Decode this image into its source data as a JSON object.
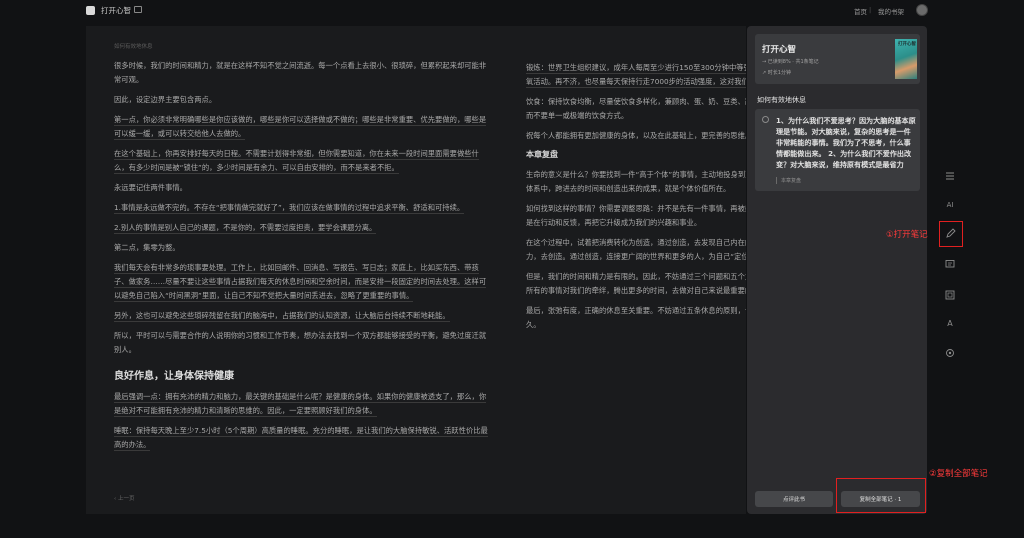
{
  "app": {
    "title": "打开心智",
    "nav_home": "首页",
    "nav_sep": "|",
    "nav_shelf": "我的书架"
  },
  "reader": {
    "chapter": "如何有效地休息",
    "left_paragraphs": [
      {
        "text": "很多时候，我们的时间和精力，就是在这样不知不觉之间流逝。每一个点看上去很小、很琐碎，但累积起来却可能非常可观。",
        "u": false
      },
      {
        "text": "因此，设定边界主要包含两点。",
        "u": false
      },
      {
        "text": "第一点，你必须非常明确哪些是你应该做的，哪些是你可以选择做或不做的；哪些是非常重要、优先要做的，哪些是可以缓一缓，或可以转交给他人去做的。",
        "u": true
      },
      {
        "text": "在这个基础上，你再安排好每天的日程。不需要计划得非常细，但你需要知道，你在未来一段时间里面需要做些什么，有多少时间是被“锁住”的，多少时间是有余力、可以自由安排的，而不是来者不拒。",
        "u": true
      },
      {
        "text": "永远要记住两件事情。",
        "u": false
      },
      {
        "text": "1.事情是永远做不完的。不存在“把事情做完就好了”，我们应该在做事情的过程中追求平衡、舒适和可持续。",
        "u": true
      },
      {
        "text": "2.别人的事情是别人自己的课题，不是你的，不需要过度担责，要学会课题分离。",
        "u": true
      },
      {
        "text": "第二点，集零为整。",
        "u": false
      },
      {
        "text": "我们每天会有非常多的琐事要处理。工作上，比如回邮件、回消息、写报告、写日志；家庭上，比如买东西、带孩子、做家务……尽量不要让这些事情占据我们每天的休息时间和空余时间，而是安排一段固定的时间去处理。这样可以避免自己陷入“时间黑洞”里面，让自己不知不觉把大量时间丢进去，忽略了更重要的事情。",
        "u": true
      },
      {
        "text": "另外，这也可以避免这些琐碎残留在我们的脑海中，占据我们的认知资源，让大脑后台持续不断地耗能。",
        "u": true
      },
      {
        "text": "所以，平时可以与需要合作的人说明你的习惯和工作节奏，想办法去找到一个双方都能够接受的平衡，避免过度迁就别人。",
        "u": false
      }
    ],
    "heading": "良好作息，让身体保持健康",
    "left_paragraphs2": [
      {
        "text": "最后强调一点：拥有充沛的精力和脑力，最关键的基础是什么呢？是健康的身体。如果你的健康被透支了，那么，你是绝对不可能拥有充沛的精力和清晰的思维的。因此，一定要照顾好我们的身体。",
        "u": true
      },
      {
        "text": "睡眠：保持每天晚上至少7.5小时（5个周期）高质量的睡眠。充分的睡眠，是让我们的大脑保持敏锐、活跃性价比最高的办法。",
        "u": true
      }
    ],
    "prev": "‹ 上一页",
    "right_paragraphs": [
      {
        "text": "锻炼：世界卫生组织建议，成年人每周至少进行150至300分钟中等强度的有氧活动。再不济，也尽量每天保持行走7000步的活动强度，这对我们身体的",
        "u": true
      },
      {
        "text": "饮食：保持饮食均衡，尽量使饮食多样化，兼顾肉、蛋、奶、豆类、蔬菜等，而不要单一或极端的饮食方式。",
        "u": false
      },
      {
        "text": "祝每个人都能拥有更加健康的身体，以及在此基础上，更完善的思维。",
        "u": false
      }
    ],
    "right_heading": "本章复盘",
    "right_paragraphs2": [
      {
        "text": "生命的意义是什么？你要找到一件“高于个体”的事情，主动地投身到更宏大的体系中，跨进去的时间和创造出来的成果，就是个体价值所在。",
        "u": false
      },
      {
        "text": "如何找到这样的事情？你需要调整思路：并不是先有一件事情，再被感召；而是在行动和反馈，再把它升级成为我们的兴趣和事业。",
        "u": false
      },
      {
        "text": "在这个过程中，试着把消费转化为创造，通过创造，去发现自己内在的驱动力，去创造。通过创造，连接更广阔的世界和更多的人，为自己“定位”。",
        "u": false
      },
      {
        "text": "但是，我们的时间和精力是有限的。因此，不妨通过三个问题和五个方向，把所有的事情对我们的牵绊，腾出更多的时间，去做对自己来说最重要的事情。",
        "u": false
      },
      {
        "text": "最后，张弛有度，正确的休息至关重要。不妨通过五条休息的原则，让自己长久。",
        "u": false
      }
    ]
  },
  "panel": {
    "book_title": "打开心智",
    "book_meta1": "→ 已读到8% · 共1条笔记",
    "book_meta2": "↗ 时长1分钟",
    "cover_title": "打开心智",
    "section_title": "如何有效地休息",
    "note_text": "1、为什么我们不爱思考？因为大脑的基本原理是节能。对大脑来说，复杂的思考是一件非常耗能的事情。我们为了不思考，什么事情都能做出来。 2、为什么我们不爱作出改变？对大脑来说，维持原有模式是最省力的…",
    "note_chapter": "本章复盘",
    "btn_review": "点评此书",
    "btn_copy": "复制全部笔记 · 1"
  },
  "tools": [
    "list-icon",
    "ai-icon",
    "pen-icon",
    "comment-icon",
    "image-icon",
    "font-icon",
    "settings-icon"
  ],
  "annotations": {
    "label1": "①打开笔记",
    "label2": "②复制全部笔记"
  }
}
